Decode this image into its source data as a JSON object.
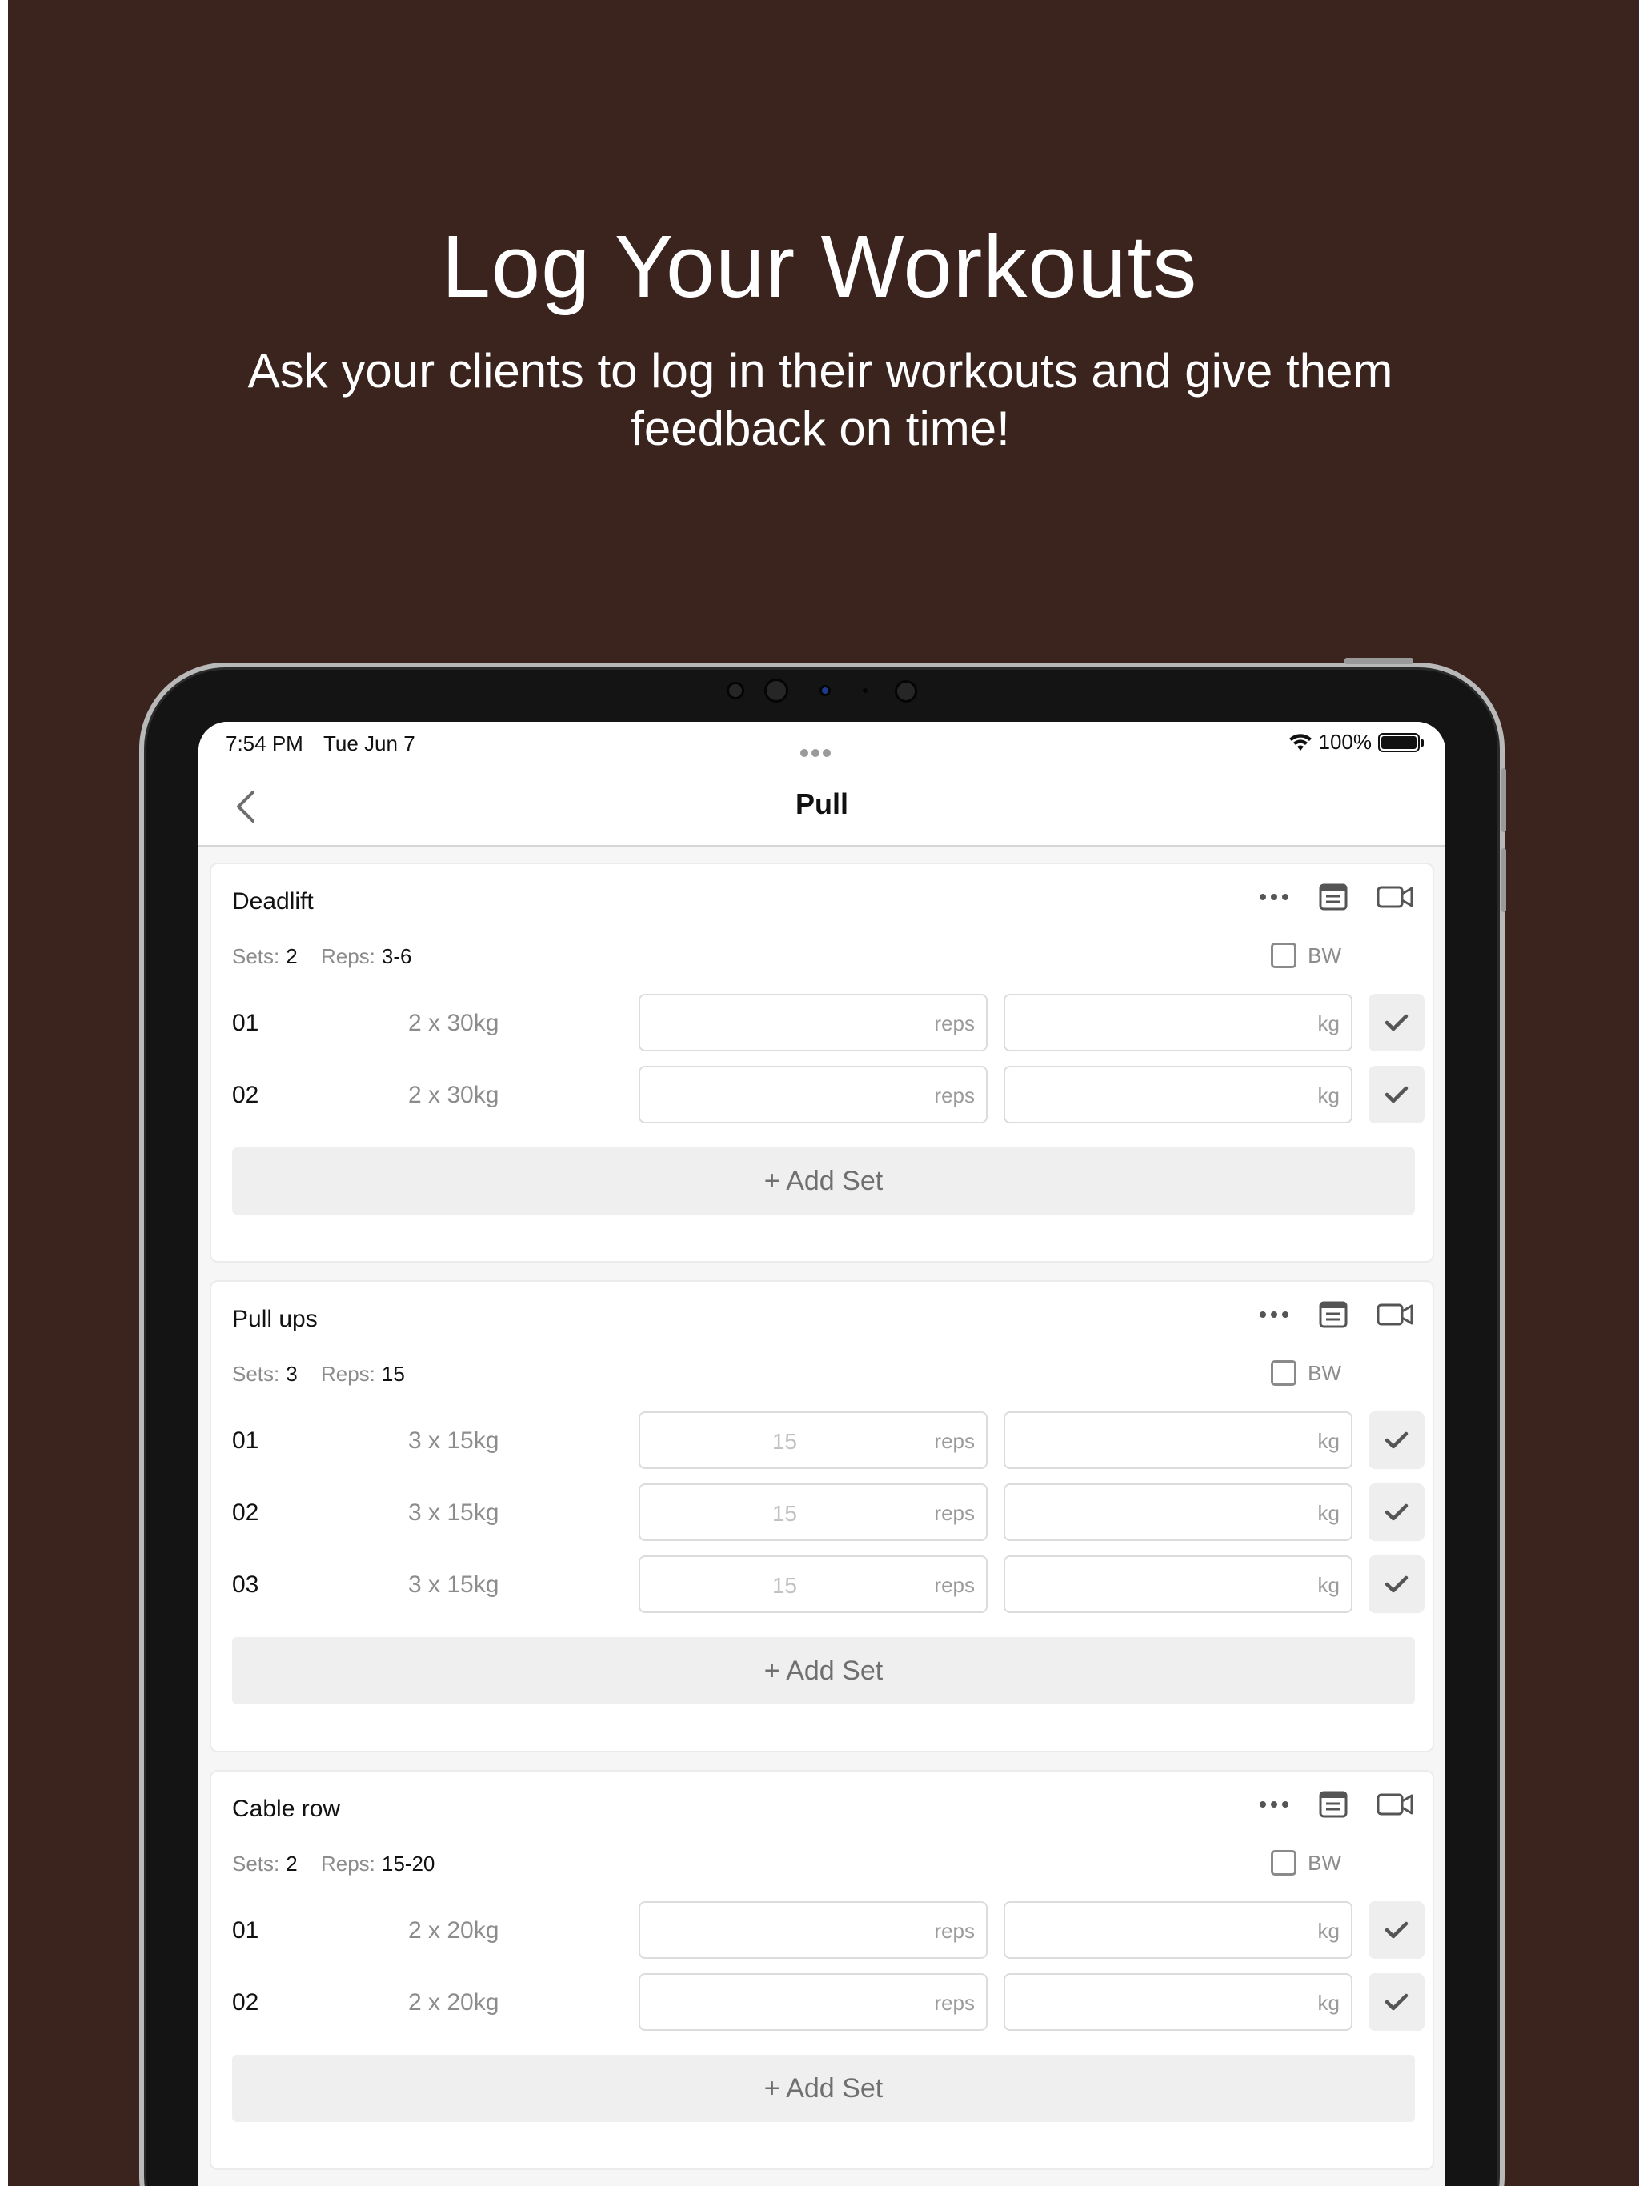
{
  "headline": "Log Your Workouts",
  "subline": "Ask your clients to log in their workouts and give them feedback on time!",
  "status": {
    "time": "7:54 PM",
    "date": "Tue Jun 7",
    "battery": "100%"
  },
  "nav": {
    "title": "Pull"
  },
  "labels": {
    "sets": "Sets:",
    "reps": "Reps:",
    "bw": "BW",
    "reps_unit": "reps",
    "kg_unit": "kg",
    "add_set": "+ Add Set"
  },
  "exercises": [
    {
      "name": "Deadlift",
      "sets": "2",
      "reps": "3-6",
      "rows": [
        {
          "num": "01",
          "target": "2 x 30kg",
          "reps_placeholder": ""
        },
        {
          "num": "02",
          "target": "2 x 30kg",
          "reps_placeholder": ""
        }
      ]
    },
    {
      "name": "Pull ups",
      "sets": "3",
      "reps": "15",
      "rows": [
        {
          "num": "01",
          "target": "3 x 15kg",
          "reps_placeholder": "15"
        },
        {
          "num": "02",
          "target": "3 x 15kg",
          "reps_placeholder": "15"
        },
        {
          "num": "03",
          "target": "3 x 15kg",
          "reps_placeholder": "15"
        }
      ]
    },
    {
      "name": "Cable row",
      "sets": "2",
      "reps": "15-20",
      "rows": [
        {
          "num": "01",
          "target": "2 x 20kg",
          "reps_placeholder": ""
        },
        {
          "num": "02",
          "target": "2 x 20kg",
          "reps_placeholder": ""
        }
      ]
    }
  ],
  "icons": {
    "back": "chevron-left-icon",
    "more": "more-horizontal-icon",
    "notes": "notes-icon",
    "video": "video-camera-icon",
    "check": "checkmark-icon",
    "wifi": "wifi-icon",
    "battery": "battery-icon"
  },
  "colors": {
    "background": "#3b241e",
    "card": "#ffffff",
    "screen": "#f6f6f6",
    "muted": "#8c8c8c"
  }
}
